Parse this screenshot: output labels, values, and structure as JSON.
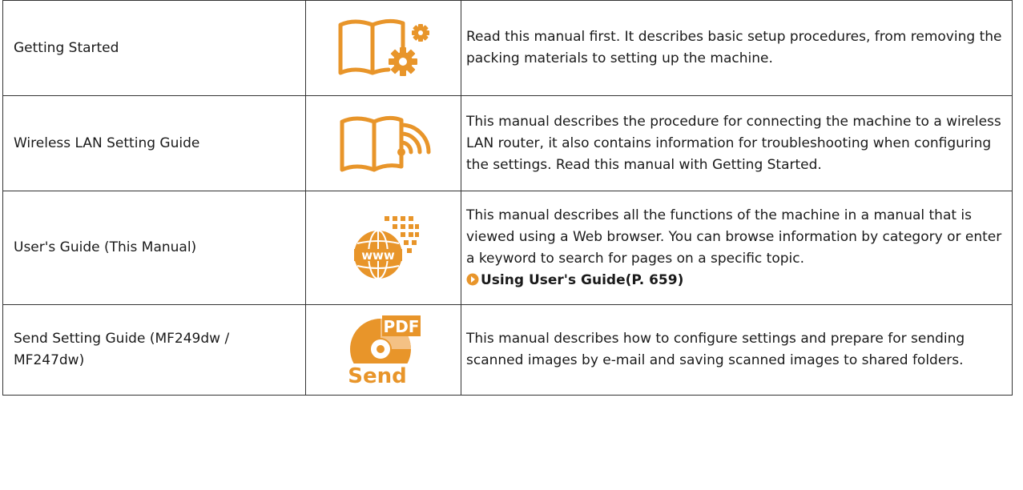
{
  "accent_color": "#e8952a",
  "rows": [
    {
      "name": "Getting Started",
      "icon": "book-gears-icon",
      "description": "Read this manual first. It describes basic setup procedures, from removing the packing materials to setting up the machine."
    },
    {
      "name": "Wireless LAN Setting Guide",
      "icon": "book-wireless-icon",
      "description": "This manual describes the procedure for connecting the machine to a wireless LAN router, it also contains information for troubleshooting when configuring the settings. Read this manual with Getting Started."
    },
    {
      "name": "User's Guide (This Manual)",
      "icon": "www-globe-icon",
      "description": "This manual describes all the functions of the machine in a manual that is viewed using a Web browser. You can browse information by category or enter a keyword to search for pages on a specific topic.",
      "link": "Using User's Guide(P. 659)"
    },
    {
      "name": "Send Setting Guide (MF249dw / MF247dw)",
      "icon": "pdf-send-icon",
      "description": "This manual describes how to configure settings and prepare for sending scanned images by e-mail and saving scanned images to shared folders.",
      "icon_text": {
        "top": "PDF",
        "bottom": "Send"
      }
    }
  ]
}
